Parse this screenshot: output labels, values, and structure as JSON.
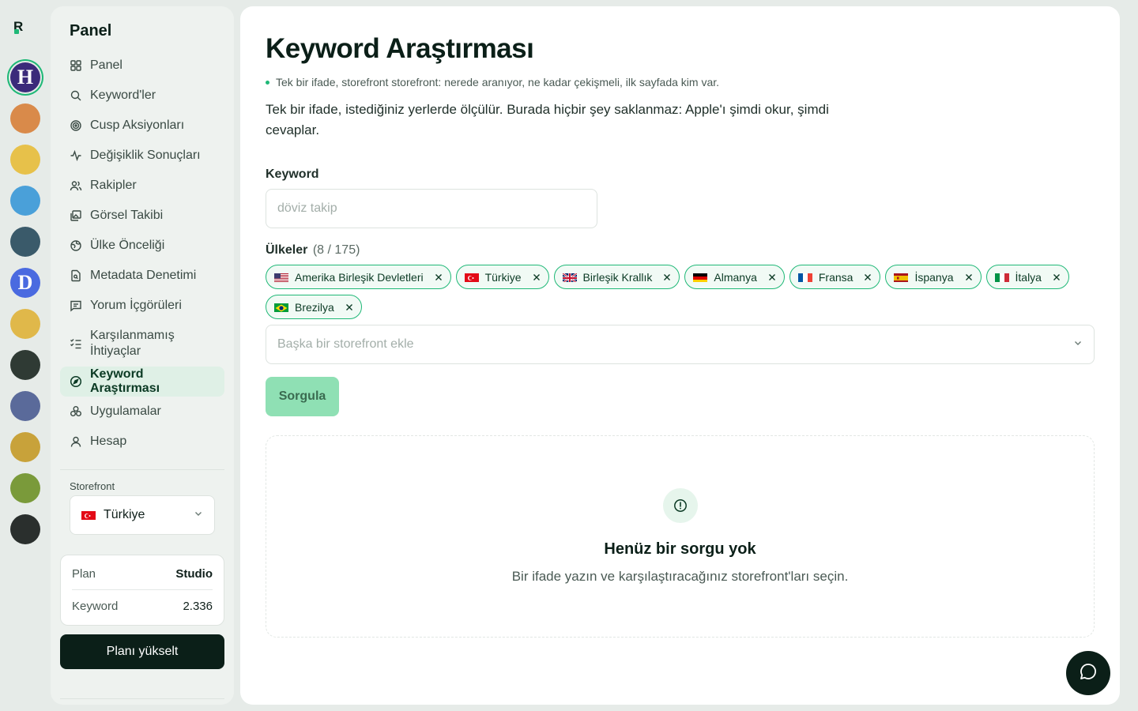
{
  "rail": {
    "apps": [
      {
        "name": "app-h",
        "letter": "H",
        "bg": "#3b2a7a",
        "active": true
      },
      {
        "name": "app-runner",
        "letter": "",
        "bg": "#d98a4a"
      },
      {
        "name": "app-gold",
        "letter": "",
        "bg": "#e7c14a"
      },
      {
        "name": "app-blocks",
        "letter": "",
        "bg": "#4aa0d9"
      },
      {
        "name": "app-chart",
        "letter": "",
        "bg": "#3a5a6a"
      },
      {
        "name": "app-d",
        "letter": "D",
        "bg": "#4a6ae0"
      },
      {
        "name": "app-ticket",
        "letter": "",
        "bg": "#e0b84a"
      },
      {
        "name": "app-investing",
        "letter": "",
        "bg": "#2f3a34"
      },
      {
        "name": "app-hero",
        "letter": "",
        "bg": "#5a6a9a"
      },
      {
        "name": "app-temple",
        "letter": "",
        "bg": "#c8a23a"
      },
      {
        "name": "app-temple2",
        "letter": "",
        "bg": "#7a9a3a"
      },
      {
        "name": "app-tv",
        "letter": "",
        "bg": "#2a2f2d"
      }
    ]
  },
  "sidebar": {
    "brand": "Panel",
    "items": [
      {
        "label": "Panel",
        "icon": "grid-icon"
      },
      {
        "label": "Keyword'ler",
        "icon": "search-icon"
      },
      {
        "label": "Cusp Aksiyonları",
        "icon": "target-icon"
      },
      {
        "label": "Değişiklik Sonuçları",
        "icon": "activity-icon"
      },
      {
        "label": "Rakipler",
        "icon": "users-icon"
      },
      {
        "label": "Görsel Takibi",
        "icon": "images-icon"
      },
      {
        "label": "Ülke Önceliği",
        "icon": "globe-icon"
      },
      {
        "label": "Metadata Denetimi",
        "icon": "file-search-icon"
      },
      {
        "label": "Yorum İçgörüleri",
        "icon": "message-icon"
      },
      {
        "label": "Karşılanmamış İhtiyaçlar",
        "icon": "list-check-icon"
      },
      {
        "label": "Keyword Araştırması",
        "icon": "compass-icon",
        "active": true
      },
      {
        "label": "Uygulamalar",
        "icon": "apps-icon"
      },
      {
        "label": "Hesap",
        "icon": "user-icon"
      }
    ],
    "storefront_label": "Storefront",
    "storefront_value": "Türkiye",
    "plan": {
      "plan_key": "Plan",
      "plan_val": "Studio",
      "kw_key": "Keyword",
      "kw_val": "2.336"
    },
    "upgrade_label": "Planı yükselt"
  },
  "main": {
    "title": "Keyword Araştırması",
    "tagline": "Tek bir ifade, storefront storefront: nerede aranıyor, ne kadar çekişmeli, ilk sayfada kim var.",
    "description": "Tek bir ifade, istediğiniz yerlerde ölçülür. Burada hiçbir şey saklanmaz: Apple'ı şimdi okur, şimdi cevaplar.",
    "keyword_label": "Keyword",
    "keyword_placeholder": "döviz takip",
    "keyword_value": "",
    "countries_label": "Ülkeler",
    "countries_count": "(8 / 175)",
    "countries": [
      {
        "label": "Amerika Birleşik Devletleri",
        "flag": "us"
      },
      {
        "label": "Türkiye",
        "flag": "tr"
      },
      {
        "label": "Birleşik Krallık",
        "flag": "gb"
      },
      {
        "label": "Almanya",
        "flag": "de"
      },
      {
        "label": "Fransa",
        "flag": "fr"
      },
      {
        "label": "İspanya",
        "flag": "es"
      },
      {
        "label": "İtalya",
        "flag": "it"
      },
      {
        "label": "Brezilya",
        "flag": "br"
      }
    ],
    "add_placeholder": "Başka bir storefront ekle",
    "query_label": "Sorgula",
    "empty_title": "Henüz bir sorgu yok",
    "empty_subtitle": "Bir ifade yazın ve karşılaştıracağınız storefront'ları seçin."
  },
  "colors": {
    "accent": "#1fb877",
    "dark": "#0b1f18",
    "active_bg": "#dff0e6",
    "button_disabled": "#8fe0b4"
  }
}
